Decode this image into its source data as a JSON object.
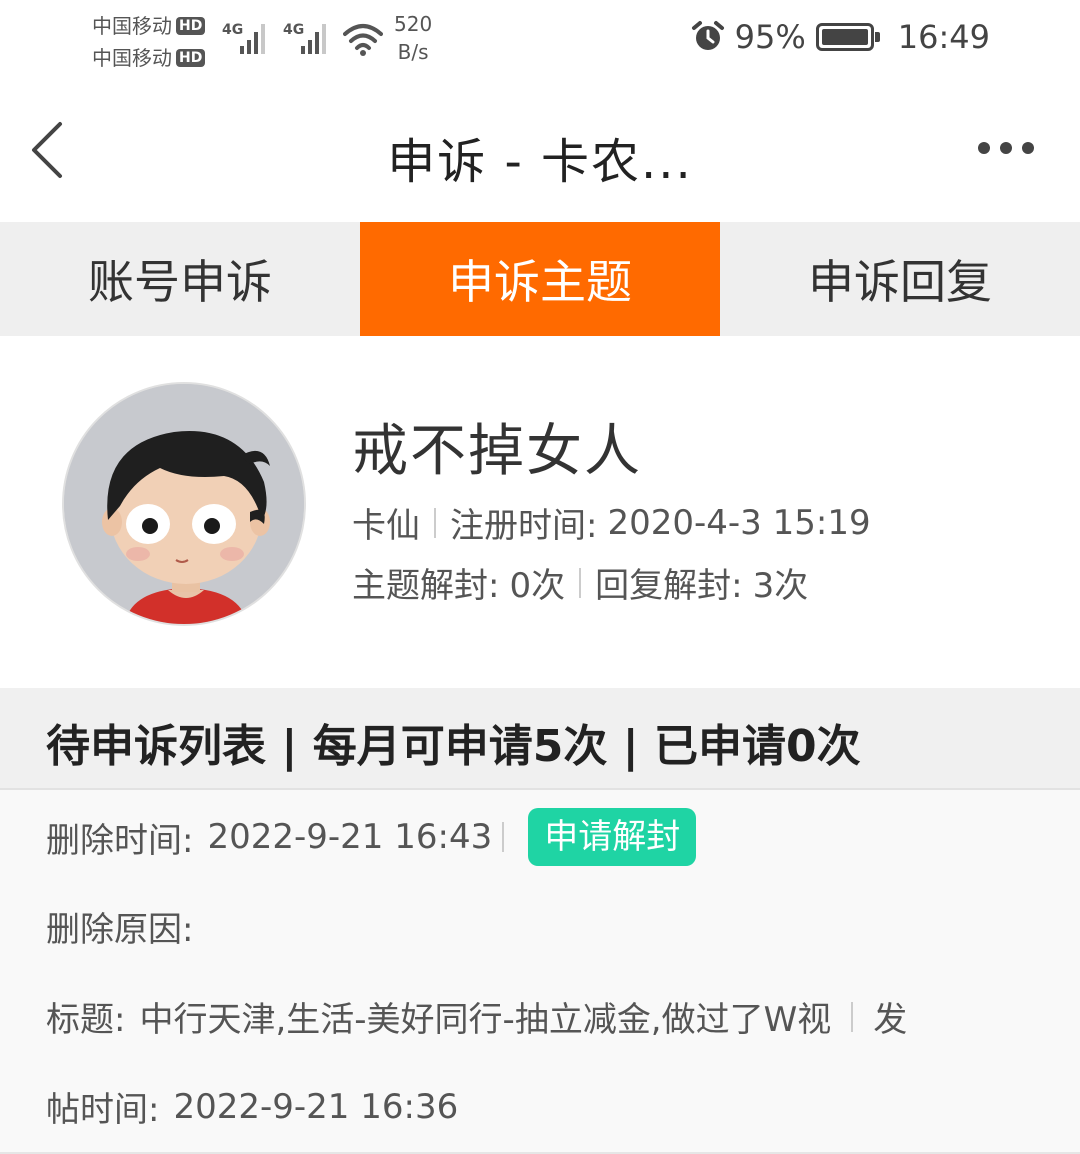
{
  "status_bar": {
    "carrier1": "中国移动",
    "carrier2": "中国移动",
    "hd_badge": "HD",
    "network_type": "4G",
    "net_speed_value": "520",
    "net_speed_unit": "B/s",
    "battery": "95%",
    "time": "16:49",
    "icons": [
      "signal-icon",
      "wifi-icon",
      "alarm-icon",
      "battery-icon"
    ]
  },
  "header": {
    "title": "申诉 - 卡农...",
    "back_icon": "chevron-left-icon",
    "more_icon": "more-horizontal-icon"
  },
  "tabs": [
    {
      "label": "账号申诉",
      "active": false
    },
    {
      "label": "申诉主题",
      "active": true
    },
    {
      "label": "申诉回复",
      "active": false
    }
  ],
  "profile": {
    "username": "戒不掉女人",
    "level": "卡仙",
    "register_label": "注册时间:",
    "register_time": "2020-4-3 15:19",
    "topic_unblock_label": "主题解封:",
    "topic_unblock_count": "0次",
    "reply_unblock_label": "回复解封:",
    "reply_unblock_count": "3次"
  },
  "list_header": "待申诉列表 | 每月可申请5次 | 已申请0次",
  "items": [
    {
      "delete_time_label": "删除时间:",
      "delete_time": "2022-9-21 16:43",
      "action_label": "申请解封",
      "reason_label": "删除原因:",
      "title_label": "标题:",
      "title_value": "中行天津,生活-美好同行-抽立减金,做过了W视",
      "post_label_part1": "发",
      "post_label_part2": "帖时间:",
      "post_time": "2022-9-21 16:36"
    }
  ],
  "colors": {
    "accent": "#ff6a00",
    "button_green": "#1fd4a4",
    "tab_bg": "#efefef"
  }
}
